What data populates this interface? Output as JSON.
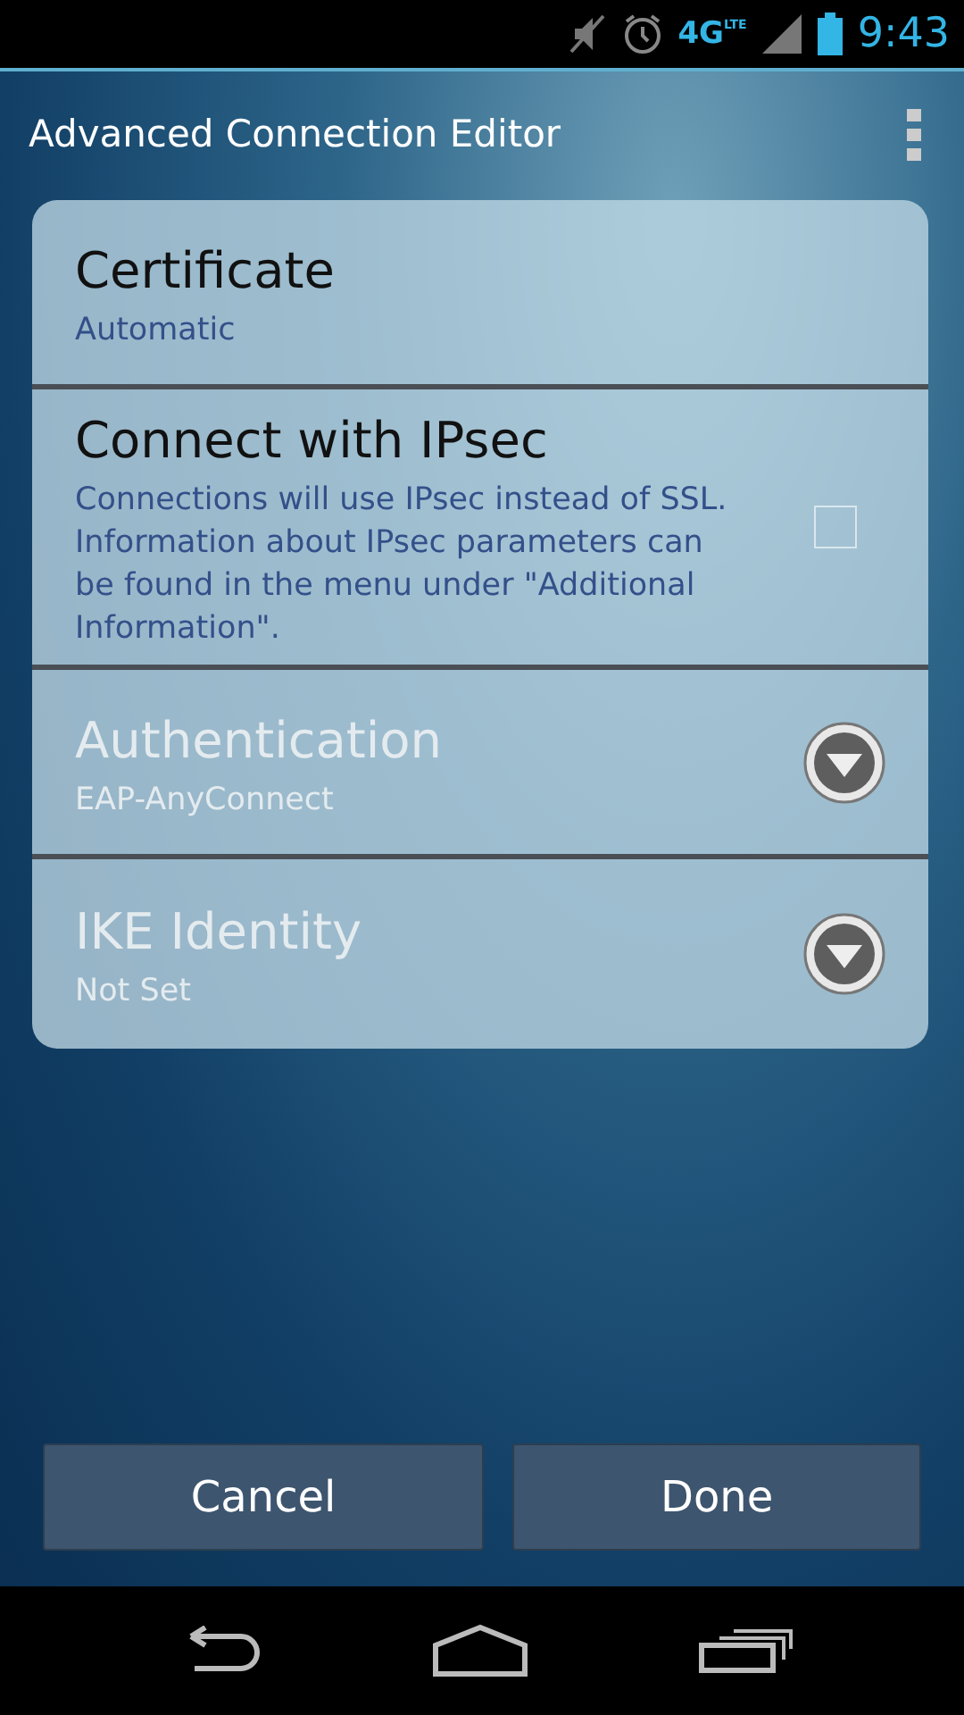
{
  "status_bar": {
    "network": "4G",
    "network_sub": "LTE",
    "time": "9:43"
  },
  "title": "Advanced Connection Editor",
  "settings": [
    {
      "kind": "value",
      "title": "Certificate",
      "summary": "Automatic",
      "disabled": false
    },
    {
      "kind": "checkbox",
      "title": "Connect with IPsec",
      "summary": "Connections will use IPsec instead of SSL. Information about IPsec parameters can be found in the menu under \"Additional Information\".",
      "checked": false,
      "disabled": false
    },
    {
      "kind": "dropdown",
      "title": "Authentication",
      "summary": "EAP-AnyConnect",
      "disabled": true
    },
    {
      "kind": "dropdown",
      "title": "IKE Identity",
      "summary": "Not Set",
      "disabled": true
    }
  ],
  "buttons": [
    {
      "label": "Cancel"
    },
    {
      "label": "Done"
    }
  ]
}
